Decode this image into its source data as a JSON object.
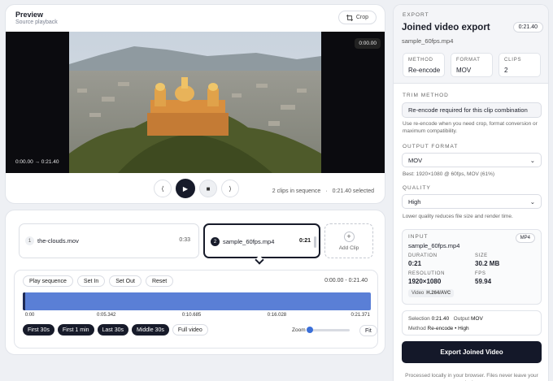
{
  "preview": {
    "title": "Preview",
    "subtitle": "Source playback",
    "crop_label": "Crop",
    "time_range": "0:00.00 → 0:21.40",
    "time_badge": "0:00.00",
    "clips_status": "2 clips in sequence",
    "selected_status": "0:21.40 selected",
    "icons": {
      "crop": "crop-icon",
      "prev": "skip-back-icon",
      "play": "play-icon",
      "stop": "stop-icon",
      "next": "skip-forward-icon"
    }
  },
  "clips": [
    {
      "index": "1",
      "name": "the-clouds.mov",
      "duration": "0:33"
    },
    {
      "index": "2",
      "name": "sample_60fps.mp4",
      "duration": "0:21"
    }
  ],
  "add_clip_label": "Add Clip",
  "editor": {
    "buttons": [
      "Play sequence",
      "Set In",
      "Set Out",
      "Reset"
    ],
    "range": "0:00.00 - 0:21.40",
    "ticks": [
      "0:00",
      "0:05.342",
      "0:10.685",
      "0:16.028",
      "0:21.371"
    ],
    "presets": [
      "First 30s",
      "First 1 min",
      "Last 30s",
      "Middle 30s",
      "Full video"
    ],
    "zoom_label": "Zoom",
    "zoom_value": 0,
    "fit_label": "Fit"
  },
  "export": {
    "section_label": "EXPORT",
    "title": "Joined video export",
    "duration_badge": "0:21.40",
    "filename": "sample_60fps.mp4",
    "stats": [
      {
        "label": "METHOD",
        "value": "Re-encode"
      },
      {
        "label": "FORMAT",
        "value": "MOV"
      },
      {
        "label": "CLIPS",
        "value": "2"
      }
    ],
    "trim_label": "TRIM METHOD",
    "trim_value": "Re-encode required for this clip combination",
    "trim_help": "Use re-encode when you need crop, format conversion or maximum compatibility.",
    "format_label": "OUTPUT FORMAT",
    "format_value": "MOV",
    "format_help": "Best: 1920×1080 @ 60fps, MOV (61%)",
    "quality_label": "QUALITY",
    "quality_value": "High",
    "quality_help": "Lower quality reduces file size and render time.",
    "input": {
      "label": "INPUT",
      "badge": "MP4",
      "filename": "sample_60fps.mp4",
      "duration_label": "DURATION",
      "duration": "0:21",
      "size_label": "SIZE",
      "size": "30.2 MB",
      "resolution_label": "RESOLUTION",
      "resolution": "1920×1080",
      "fps_label": "FPS",
      "fps": "59.94",
      "codec_label": "Video",
      "codec": "H.264/AVC"
    },
    "summary": {
      "selection_label": "Selection",
      "selection": "0:21.40",
      "output_label": "Output",
      "output": "MOV",
      "method_label": "Method",
      "method": "Re-encode • High"
    },
    "export_button": "Export Joined Video",
    "footer": "Processed locally in your browser. Files never leave your device."
  },
  "colors": {
    "accent": "#171b2a",
    "track": "#5a7fd6",
    "zoom_thumb": "#3b6fd8"
  }
}
